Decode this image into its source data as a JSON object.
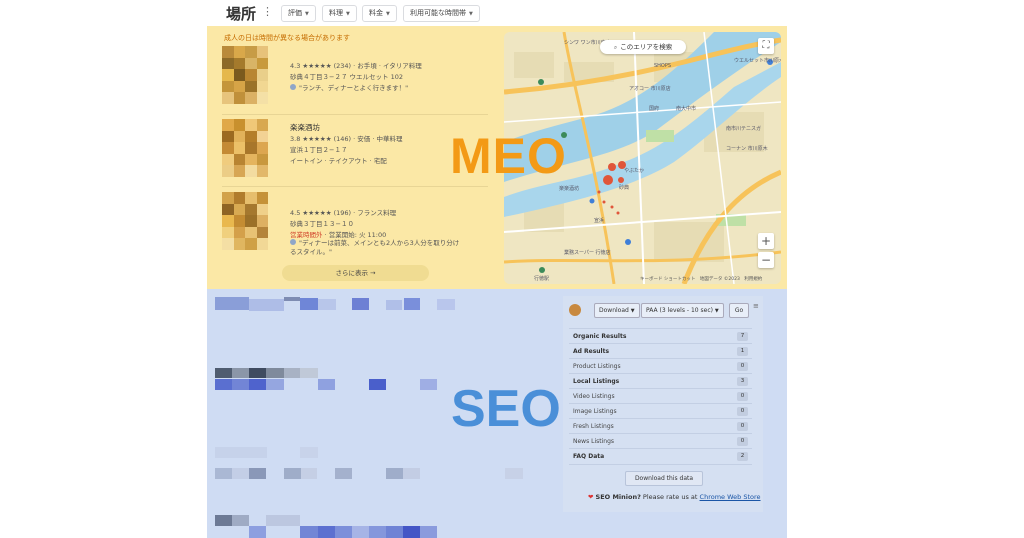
{
  "header": {
    "title": "場所",
    "more_icon": "⋮",
    "chips": [
      {
        "label": "評価"
      },
      {
        "label": "料理"
      },
      {
        "label": "料金"
      },
      {
        "label": "利用可能な時間帯"
      }
    ]
  },
  "meo": {
    "notice": "成人の日は時間が異なる場合があります",
    "label": "MEO",
    "listings": [
      {
        "name": "",
        "rating_line": "4.3 ★★★★★ (234) · お手頃 · イタリア料理",
        "address": "砂典４丁目３−２７ ウエルセット 102",
        "review": "\"ランチ、ディナーとよく行きます！\"",
        "status": "",
        "hours": ""
      },
      {
        "name": "楽楽酒坊",
        "rating_line": "3.8 ★★★★★ (146) · 安価 · 中華料理",
        "address": "宣浜１丁目２−１７",
        "review": "イートイン · テイクアウト · 宅配",
        "status": "",
        "hours": ""
      },
      {
        "name": "",
        "rating_line": "4.5 ★★★★★ (196) · フランス料理",
        "address": "砂典３丁目１３−１０",
        "review": "\"ディナーは前菜、メインとも2人から3人分を取り分けるスタイル。\"",
        "status": "営業時間外",
        "hours": " · 営業開始: 火 11:00"
      }
    ],
    "more_button": "さらに表示 →",
    "map": {
      "search_label": "このエリアを検索",
      "zoom_in": "+",
      "zoom_out": "−",
      "fullscreen": "⛶",
      "footer": "キーボード ショートカット　地図データ ©2023　利用規約",
      "places": [
        "シンワ ワン市川東店",
        "アオコー 市川原店",
        "国府",
        "南大中市",
        "コーナン 市川原木",
        "南市川テニスガ",
        "楽楽酒坊",
        "砂典",
        "ヤマ",
        "業務スーパー 行徳店",
        "行徳駅",
        "やぶたか",
        "行徳",
        "ウエルセット市川原木店",
        "SHOPS",
        "ここ"
      ],
      "colors": {
        "water": "#9fd0e8",
        "road": "#f7c35a",
        "park": "#bfe0a6",
        "pin": "#e0563a"
      }
    }
  },
  "seo": {
    "label": "SEO",
    "widget": {
      "download_select": "Download",
      "paa_select": "PAA (3 levels - 10 sec)",
      "go": "Go",
      "menu": "≡",
      "rows": [
        {
          "label": "Organic Results",
          "count": "7",
          "bold": true
        },
        {
          "label": "Ad Results",
          "count": "1",
          "bold": true
        },
        {
          "label": "Product Listings",
          "count": "0",
          "bold": false
        },
        {
          "label": "Local Listings",
          "count": "3",
          "bold": true
        },
        {
          "label": "Video Listings",
          "count": "0",
          "bold": false
        },
        {
          "label": "Image Listings",
          "count": "0",
          "bold": false
        },
        {
          "label": "Fresh Listings",
          "count": "0",
          "bold": false
        },
        {
          "label": "News Listings",
          "count": "0",
          "bold": false
        },
        {
          "label": "FAQ Data",
          "count": "2",
          "bold": true
        }
      ],
      "download_data": "Download this data",
      "rate_heart": "❤",
      "rate_brand": "SEO Minion?",
      "rate_text": " Please rate us at ",
      "rate_link": "Chrome Web Store"
    }
  },
  "colors": {
    "meo_bg": "#fbe8a6",
    "seo_bg": "#cfdcf3",
    "meo_accent": "#f39a16",
    "seo_accent": "#4a8fd8"
  }
}
